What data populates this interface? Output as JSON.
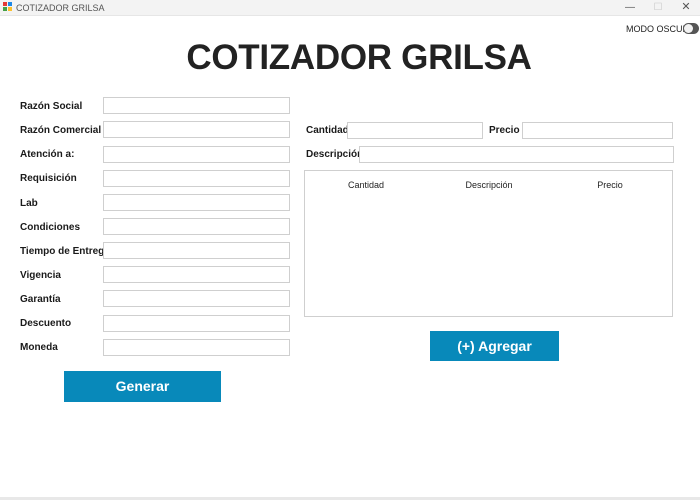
{
  "window": {
    "title": "COTIZADOR GRILSA",
    "minimize_glyph": "—",
    "maximize_glyph": "☐",
    "close_glyph": "✕"
  },
  "dark_mode": {
    "label": "MODO OSCURO",
    "enabled": false
  },
  "heading": "COTIZADOR GRILSA",
  "form": {
    "razon_social": "Razón Social",
    "razon_comercial": "Razón Comercial",
    "atencion": "Atención a:",
    "requisicion": "Requisición",
    "lab": "Lab",
    "condiciones": "Condiciones",
    "tiempo_entrega": "Tiempo de Entrega",
    "vigencia": "Vigencia",
    "garantia": "Garantía",
    "descuento": "Descuento",
    "moneda": "Moneda"
  },
  "product": {
    "cantidad_label": "Cantidad",
    "precio_label": "Precio",
    "descripcion_label": "Descripción"
  },
  "table": {
    "columns": [
      "Cantidad",
      "Descripción",
      "Precio"
    ],
    "rows": []
  },
  "buttons": {
    "add_product": "(+) Agregar producto",
    "generate": "Generar"
  },
  "colors": {
    "accent": "#0889ba",
    "icon_colors": [
      "#e53935",
      "#1e88e5",
      "#43a047",
      "#fbc02d"
    ]
  }
}
